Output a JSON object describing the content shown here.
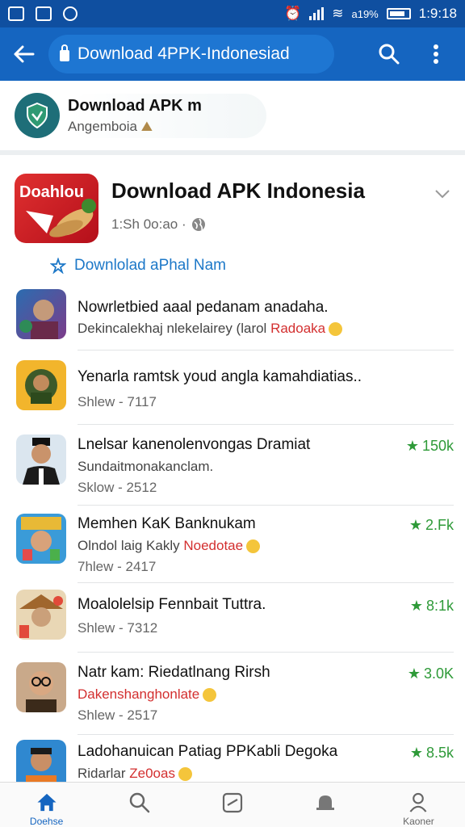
{
  "status_bar": {
    "time": "1:9:18",
    "battery_label": "a19%"
  },
  "app_bar": {
    "url_text": "Download 4PPK-Indonesiad"
  },
  "profile": {
    "title": "Download APK m",
    "subtitle": "Angemboia"
  },
  "post": {
    "logo_text": "Doahlou",
    "title": "Download APK Indonesia",
    "time": "1:Sh 0o:ao ·",
    "link_text": "Downlolad aPhal Nam"
  },
  "items": [
    {
      "line1": "Nowrletbied aaal pedanam anadaha.",
      "line2_prefix": "Dekincalekhaj nlekelairey (larol ",
      "line2_red": "Radoaka",
      "line3": "",
      "rating": ""
    },
    {
      "line1": "Yenarla ramtsk youd angla kamahdiatias..",
      "line2_prefix": "",
      "line2_red": "",
      "line3": "Shlew - 7117",
      "rating": ""
    },
    {
      "line1": "Lnelsar kanenolenvongas Dramiat",
      "line2_prefix": "Sundaitmonakanclam.",
      "line2_red": "",
      "line3": "Sklow - 2512",
      "rating": "150k"
    },
    {
      "line1": "Memhen KaK Banknukam",
      "line2_prefix": "Olndol laig Kakly ",
      "line2_red": "Noedotae",
      "line3": "7hlew - 2417",
      "rating": "2.Fk"
    },
    {
      "line1": "Moalolelsip Fennbait Tuttra.",
      "line2_prefix": "",
      "line2_red": "",
      "line3": "Shlew - 7312",
      "rating": "8:1k"
    },
    {
      "line1": "Natr kam: Riedatlnang Rirsh",
      "line2_prefix": "",
      "line2_red": "Dakenshanghonlate",
      "line3": "Shlew - 2517",
      "rating": "3.0K"
    },
    {
      "line1": "Ladohanuican Patiag PPKabli Degoka",
      "line2_prefix": "Ridarlar ",
      "line2_red": "Ze0oas",
      "line3": "",
      "rating": "8.5k"
    }
  ],
  "bottom_nav": {
    "home_label": "Doehse",
    "profile_label": "Kaoner"
  },
  "colors": {
    "app_bar": "#1565c0",
    "status_bar": "#0f4fa0",
    "rating_green": "#2e9a38",
    "accent_red": "#d32f2f",
    "link_blue": "#1d78c8"
  }
}
